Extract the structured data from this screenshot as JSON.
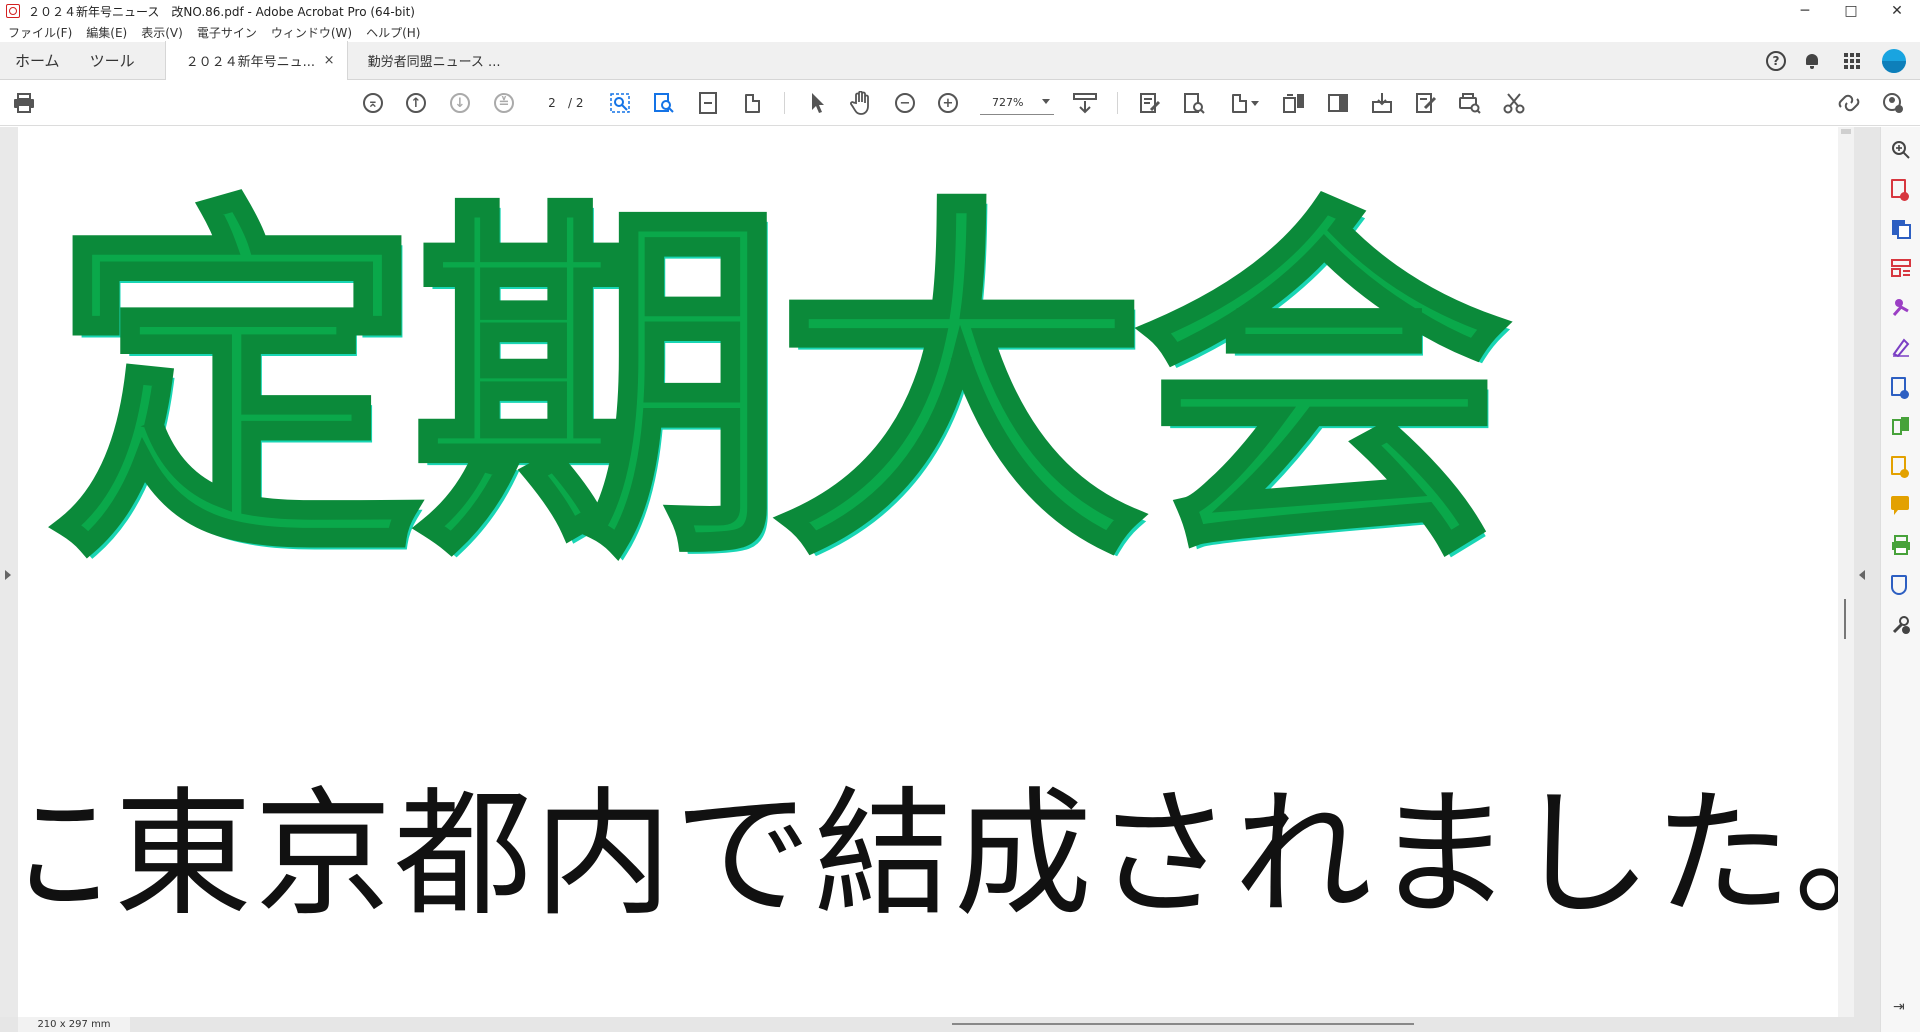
{
  "window": {
    "title": "２０２４新年号ニュース　改NO.86.pdf - Adobe Acrobat Pro (64-bit)",
    "controls": {
      "minimize": "─",
      "maximize": "□",
      "close": "✕"
    }
  },
  "menu": [
    "ファイル(F)",
    "編集(E)",
    "表示(V)",
    "電子サイン",
    "ウィンドウ(W)",
    "ヘルプ(H)"
  ],
  "tabs": {
    "home": "ホーム",
    "tools": "ツール",
    "documents": [
      {
        "label": "２０２４新年号ニュ...",
        "active": true,
        "close": "×"
      },
      {
        "label": "勤労者同盟ニュース ...",
        "active": false
      }
    ],
    "help": "?"
  },
  "toolbar": {
    "page_current": "2",
    "page_total": "/ 2",
    "zoom": "727%",
    "icons": [
      "print-icon",
      "first-page-icon",
      "prev-page-icon",
      "next-page-icon",
      "last-page-icon",
      "zoom-marquee-icon",
      "find-icon",
      "fit-width-icon",
      "page-icon",
      "select-icon",
      "hand-icon",
      "zoom-out-icon",
      "zoom-in-icon",
      "scroll-mode-icon",
      "comment-icon",
      "export-icon",
      "create-icon",
      "organize-icon",
      "redact-icon",
      "compress-icon",
      "edit-icon",
      "scan-icon",
      "cut-icon",
      "share-icon",
      "account-icon"
    ]
  },
  "document": {
    "heading": "定期大会",
    "body_line": "に東京都内で結成されました。",
    "colors": {
      "heading_fill": "#0aa84a",
      "heading_edge": "#0b8a3a",
      "heading_shadow": "#19d6b4"
    }
  },
  "status": {
    "page_size": "210 x 297 mm"
  },
  "right_pane_icons": [
    "search-zoom-icon",
    "export-pdf-icon",
    "create-pdf-icon",
    "organize-pages-icon",
    "edit-pdf-icon",
    "fill-sign-icon",
    "add-pdf-icon",
    "compare-icon",
    "request-sign-icon",
    "comment-icon",
    "print-production-icon",
    "protect-icon",
    "more-tools-icon",
    "collapse-pane-icon"
  ]
}
